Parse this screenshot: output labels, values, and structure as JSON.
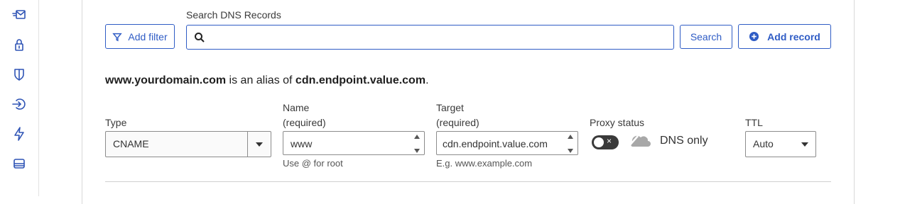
{
  "sidebar": {
    "icons": [
      "email-routing-icon",
      "lock-icon",
      "shield-icon",
      "traffic-icon",
      "speed-icon",
      "storage-icon"
    ]
  },
  "toolbar": {
    "add_filter_label": "Add filter",
    "search_label": "Search DNS Records",
    "search_placeholder": "",
    "search_button_label": "Search",
    "add_record_label": "Add record"
  },
  "alias": {
    "domain": "www.yourdomain.com",
    "middle": " is an alias of ",
    "target": "cdn.endpoint.value.com",
    "end": "."
  },
  "form": {
    "type_label": "Type",
    "type_value": "CNAME",
    "name_label": "Name",
    "name_required": "(required)",
    "name_value": "www",
    "name_hint": "Use @ for root",
    "target_label": "Target",
    "target_required": "(required)",
    "target_value": "cdn.endpoint.value.com",
    "target_hint": "E.g. www.example.com",
    "proxy_label": "Proxy status",
    "proxy_value": "DNS only",
    "ttl_label": "TTL",
    "ttl_value": "Auto"
  },
  "colors": {
    "accent": "#2f5cc5",
    "sidebar_icon": "#2f54b5",
    "toggle_off": "#3a3a3a"
  }
}
